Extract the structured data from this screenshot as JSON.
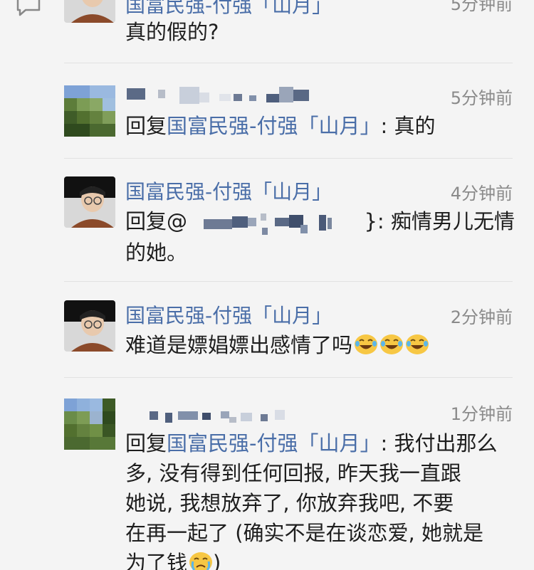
{
  "comments": [
    {
      "name": "国富民强-付强「山月」",
      "time": "5分钟前",
      "text": "真的假的?"
    },
    {
      "name": "",
      "time": "5分钟前",
      "reply_prefix": "回复",
      "reply_to": "国富民强-付强「山月」",
      "text": ": 真的"
    },
    {
      "name": "国富民强-付强「山月」",
      "time": "4分钟前",
      "reply_prefix": "回复@",
      "reply_tail": "}: 痴情男儿无情",
      "text_line2": "的她。"
    },
    {
      "name": "国富民强-付强「山月」",
      "time": "2分钟前",
      "text": "难道是嫖娼嫖出感情了吗"
    },
    {
      "name": "",
      "time": "1分钟前",
      "reply_prefix": "回复",
      "reply_to": "国富民强-付强「山月」",
      "text_line1": ": 我付出那么",
      "text_line2": "多, 没有得到任何回报, 昨天我一直跟",
      "text_line3": "她说, 我想放弃了, 你放弃我吧, 不要",
      "text_line4": "在再一起了 (确实不是在谈恋爱, 她就是",
      "text_line5": "为了钱",
      "text_line5_tail": ")"
    }
  ],
  "icons": {
    "comment": "comment-icon",
    "laugh": "laughing-tears-emoji",
    "cry": "crying-emoji"
  },
  "colors": {
    "link": "#4a6ea8",
    "time": "#8a8a8a",
    "background": "#f4f4f4"
  }
}
